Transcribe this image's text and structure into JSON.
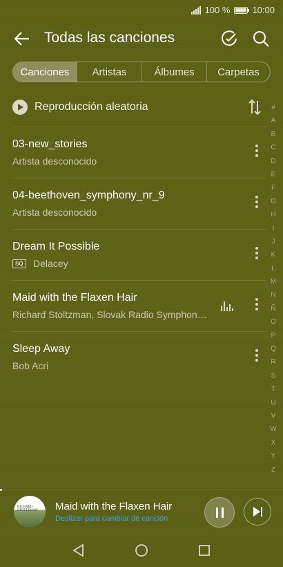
{
  "status_bar": {
    "battery_text": "100 %",
    "time": "10:00",
    "battery_level": 1.0
  },
  "header": {
    "title": "Todas las canciones",
    "back_icon": "arrow-left-icon",
    "edit_icon": "edit-check-icon",
    "search_icon": "search-icon"
  },
  "tabs": [
    {
      "label": "Canciones",
      "active": true
    },
    {
      "label": "Artistas",
      "active": false
    },
    {
      "label": "Álbumes",
      "active": false
    },
    {
      "label": "Carpetas",
      "active": false
    }
  ],
  "shuffle": {
    "label": "Reproducción aleatoria",
    "icon": "play-circle-icon",
    "sort_icon": "sort-icon"
  },
  "songs": [
    {
      "title": "03-new_stories",
      "artist": "Artista desconocido",
      "badge": "",
      "playing": false
    },
    {
      "title": "04-beethoven_symphony_nr_9",
      "artist": "Artista desconocido",
      "badge": "",
      "playing": false
    },
    {
      "title": "Dream It Possible",
      "artist": "Delacey",
      "badge": "SQ",
      "playing": false
    },
    {
      "title": "Maid with the Flaxen Hair",
      "artist": "Richard Stoltzman, Slovak Radio Symphony Orchestra",
      "badge": "",
      "playing": true
    },
    {
      "title": "Sleep Away",
      "artist": "Bob Acri",
      "badge": "",
      "playing": false
    }
  ],
  "index_letters": [
    "#",
    "A",
    "B",
    "C",
    "D",
    "E",
    "F",
    "G",
    "H",
    "I",
    "J",
    "K",
    "L",
    "M",
    "N",
    "Ñ",
    "O",
    "P",
    "Q",
    "R",
    "S",
    "T",
    "U",
    "V",
    "W",
    "X",
    "Y",
    "Z"
  ],
  "player": {
    "title": "Maid with the Flaxen Hair",
    "hint": "Deslizar para cambiar de canción",
    "cover_text": "RICHARD STOLTZMAN",
    "hint_color": "#37a6f0"
  },
  "colors": {
    "background": "#5c6117",
    "accent": "#37a6f0"
  }
}
